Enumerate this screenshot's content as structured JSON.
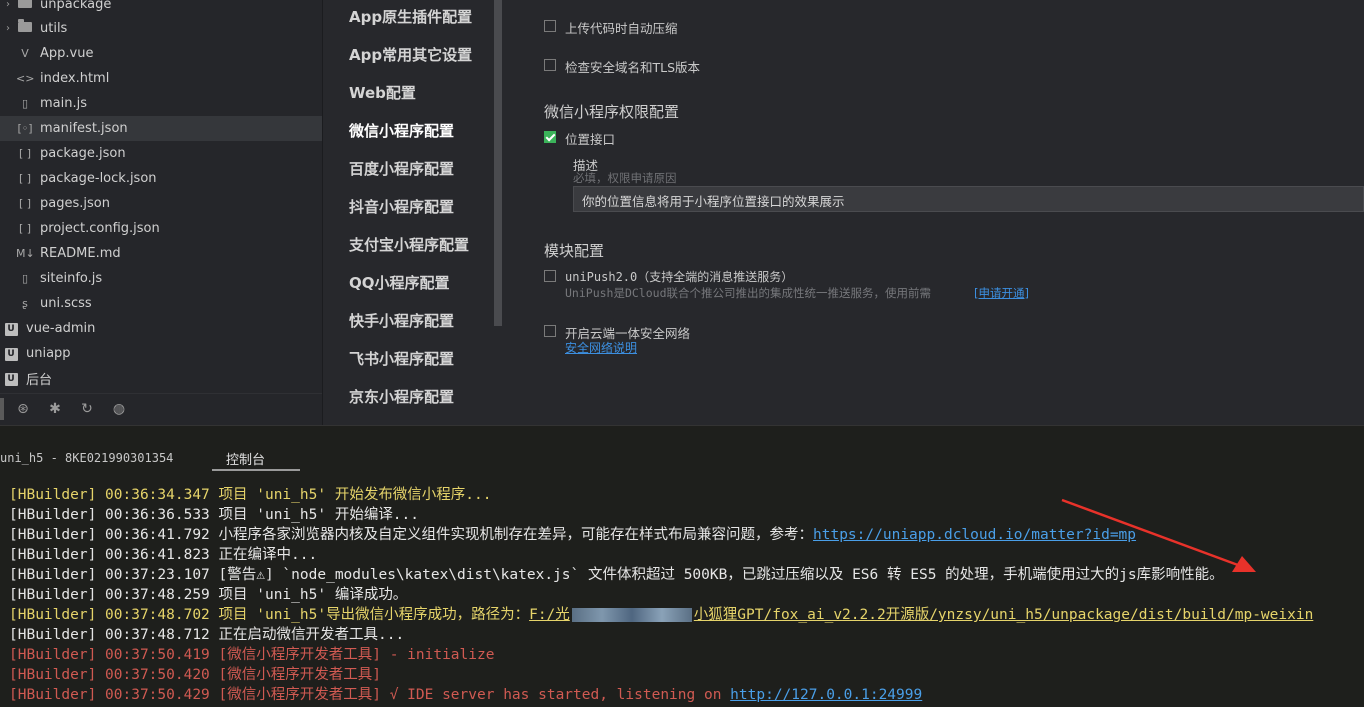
{
  "tree": {
    "items": [
      {
        "label": "unpackage",
        "type": "folder",
        "collapsed": true
      },
      {
        "label": "utils",
        "type": "folder",
        "collapsed": true
      },
      {
        "label": "App.vue",
        "type": "vue",
        "icon": "V"
      },
      {
        "label": "index.html",
        "type": "html",
        "icon": "<>"
      },
      {
        "label": "main.js",
        "type": "file",
        "icon": "▯"
      },
      {
        "label": "manifest.json",
        "type": "json",
        "icon": "[◦]",
        "selected": true
      },
      {
        "label": "package.json",
        "type": "json",
        "icon": "[ ]"
      },
      {
        "label": "package-lock.json",
        "type": "json",
        "icon": "[ ]"
      },
      {
        "label": "pages.json",
        "type": "json",
        "icon": "[ ]"
      },
      {
        "label": "project.config.json",
        "type": "json",
        "icon": "[ ]"
      },
      {
        "label": "README.md",
        "type": "md",
        "icon": "M↓"
      },
      {
        "label": "siteinfo.js",
        "type": "file",
        "icon": "▯"
      },
      {
        "label": "uni.scss",
        "type": "scss",
        "icon": "ʂ"
      },
      {
        "label": "vue-admin",
        "type": "project",
        "icon": "U"
      },
      {
        "label": "uniapp",
        "type": "project",
        "icon": "U"
      },
      {
        "label": "后台",
        "type": "project",
        "icon": "U"
      }
    ],
    "toolbar_icons": [
      "binoculars-icon",
      "bug-icon",
      "refresh-icon",
      "globe-icon"
    ]
  },
  "nav": {
    "items": [
      "App原生插件配置",
      "App常用其它设置",
      "Web配置",
      "微信小程序配置",
      "百度小程序配置",
      "抖音小程序配置",
      "支付宝小程序配置",
      "QQ小程序配置",
      "快手小程序配置",
      "飞书小程序配置",
      "京东小程序配置"
    ]
  },
  "panel": {
    "upload_compress": "上传代码时自动压缩",
    "check_domain": "检查安全域名和TLS版本",
    "perm_heading": "微信小程序权限配置",
    "location_label": "位置接口",
    "desc_label": "描述",
    "desc_hint": "必填，权限申请原因",
    "desc_value": "你的位置信息将用于小程序位置接口的效果展示",
    "module_heading": "模块配置",
    "unipush_label": "uniPush2.0（支持全端的消息推送服务）",
    "unipush_desc": "UniPush是DCloud联合个推公司推出的集成性统一推送服务，使用前需",
    "unipush_link": "[申请开通]",
    "security_label": "开启云端一体安全网络",
    "security_link": "安全网络说明"
  },
  "console": {
    "device_tab": "uni_h5 - 8KE021990301354",
    "console_tab": "控制台",
    "lines": [
      {
        "prefix": "[HBuilder] 00:36:34.347 ",
        "text": "项目 'uni_h5' 开始发布微信小程序...",
        "color": "yellow"
      },
      {
        "prefix": "[HBuilder] 00:36:36.533 ",
        "text": "项目 'uni_h5' 开始编译...",
        "color": "white"
      },
      {
        "prefix": "[HBuilder] 00:36:41.792 ",
        "text": "小程序各家浏览器内核及自定义组件实现机制存在差异，可能存在样式布局兼容问题，参考：",
        "link": "https://uniapp.dcloud.io/matter?id=mp",
        "color": "white"
      },
      {
        "prefix": "[HBuilder] 00:36:41.823 ",
        "text": "正在编译中...",
        "color": "white"
      },
      {
        "prefix": "[HBuilder] 00:37:23.107 ",
        "text": "[警告⚠] `node_modules\\katex\\dist\\katex.js` 文件体积超过 500KB，已跳过压缩以及 ES6 转 ES5 的处理，手机端使用过大的js库影响性能。",
        "color": "white"
      },
      {
        "prefix": "[HBuilder] 00:37:48.259 ",
        "text": "项目 'uni_h5' 编译成功。",
        "color": "white"
      },
      {
        "prefix": "[HBuilder] 00:37:48.702 ",
        "text": "项目 'uni_h5'导出微信小程序成功，路径为：",
        "link_pre": "F:/光",
        "link": "小狐狸GPT/fox_ai_v2.2.2开源版/ynzsy/uni_h5/unpackage/dist/build/mp-weixin",
        "color": "yellow"
      },
      {
        "prefix": "[HBuilder] 00:37:48.712 ",
        "text": "正在启动微信开发者工具...",
        "color": "white"
      },
      {
        "prefix": "[HBuilder] 00:37:50.419 ",
        "text": "[微信小程序开发者工具] - initialize",
        "color": "red"
      },
      {
        "prefix": "[HBuilder] 00:37:50.420 ",
        "text": "[微信小程序开发者工具]",
        "color": "red"
      },
      {
        "prefix": "[HBuilder] 00:37:50.429 ",
        "text": "[微信小程序开发者工具] √ IDE server has started, listening on ",
        "link": "http://127.0.0.1:24999",
        "color": "red"
      }
    ]
  },
  "colors": {
    "checkbox_checked": "#3bb35a",
    "arrow": "#e8322a",
    "log_yellow": "#e6d46a",
    "log_red": "#d05a52",
    "link": "#4a9fe8"
  }
}
